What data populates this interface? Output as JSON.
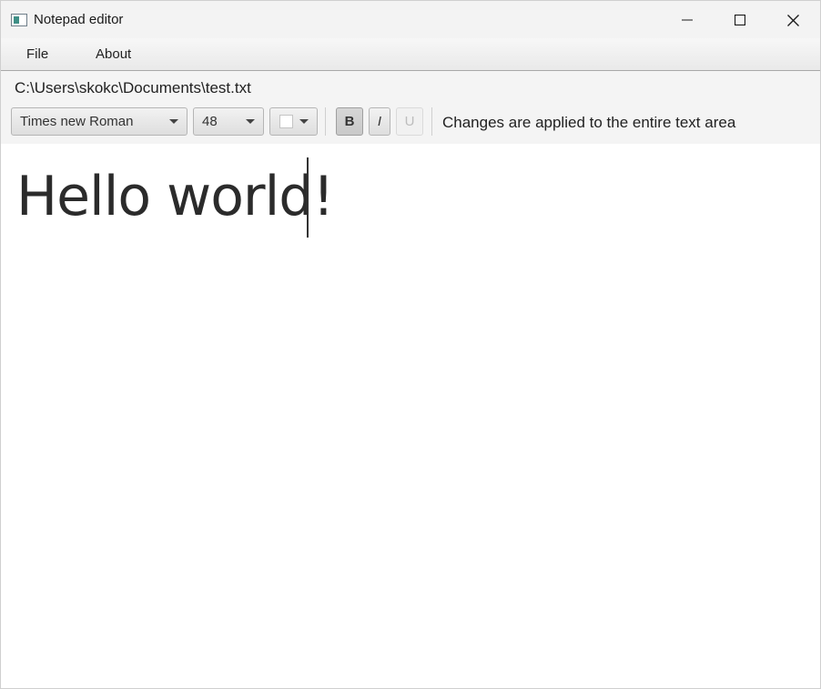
{
  "window": {
    "title": "Notepad editor",
    "icons": {
      "app": "notepad-icon",
      "minimize": "minimize-icon",
      "maximize": "maximize-icon",
      "close": "close-icon"
    }
  },
  "menu": {
    "items": [
      {
        "label": "File"
      },
      {
        "label": "About"
      }
    ]
  },
  "file": {
    "path": "C:\\Users\\skokc\\Documents\\test.txt"
  },
  "toolbar": {
    "font_family": "Times new Roman",
    "font_size": "48",
    "text_color": "#ffffff",
    "bold_label": "B",
    "bold_selected": true,
    "italic_label": "I",
    "underline_label": "U",
    "underline_enabled": false,
    "hint": "Changes are applied to the entire text area"
  },
  "editor": {
    "content": "Hello world!"
  }
}
